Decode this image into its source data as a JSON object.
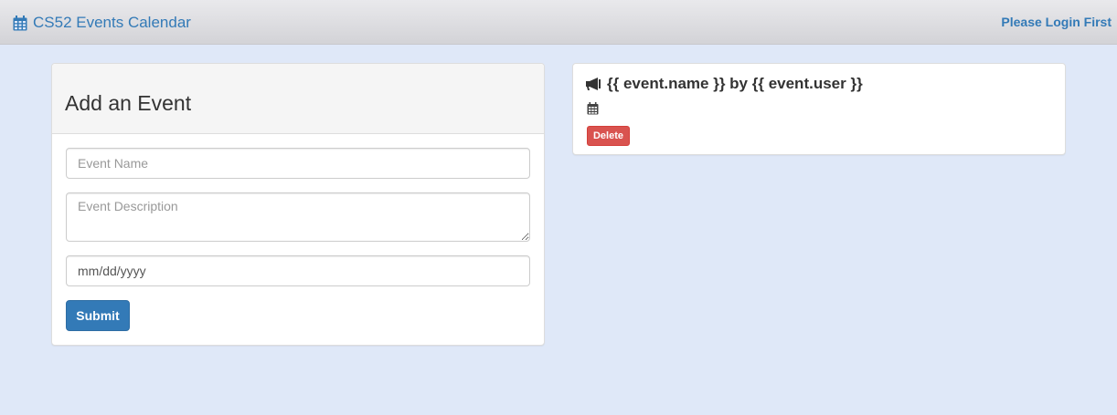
{
  "navbar": {
    "brand": "CS52 Events Calendar",
    "login": "Please Login First",
    "brand_icon": "calendar-icon"
  },
  "form": {
    "heading": "Add an Event",
    "name_placeholder": "Event Name",
    "description_placeholder": "Event Description",
    "date_placeholder": "mm/dd/yyyy",
    "submit_label": "Submit"
  },
  "event": {
    "title": "{{ event.name }} by {{ event.user }}",
    "title_icon": "megaphone-icon",
    "date_icon": "calendar-icon",
    "delete_label": "Delete"
  },
  "colors": {
    "background": "#dfe8f8",
    "primary": "#337ab7",
    "danger": "#d9534f"
  }
}
